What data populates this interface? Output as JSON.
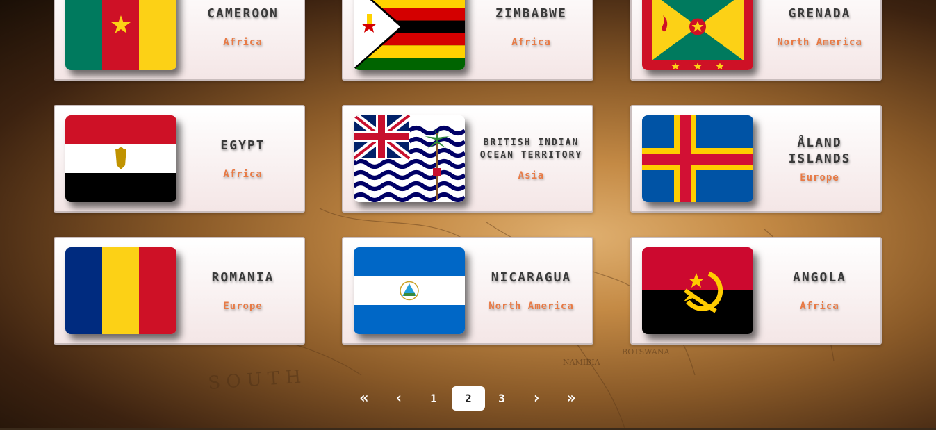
{
  "countries": [
    {
      "name": "CAMEROON",
      "region": "Africa"
    },
    {
      "name": "ZIMBABWE",
      "region": "Africa"
    },
    {
      "name": "GRENADA",
      "region": "North America"
    },
    {
      "name": "EGYPT",
      "region": "Africa"
    },
    {
      "name": "BRITISH INDIAN OCEAN TERRITORY",
      "region": "Asia"
    },
    {
      "name": "ÅLAND ISLANDS",
      "region": "Europe"
    },
    {
      "name": "ROMANIA",
      "region": "Europe"
    },
    {
      "name": "NICARAGUA",
      "region": "North America"
    },
    {
      "name": "ANGOLA",
      "region": "Africa"
    }
  ],
  "pagination": {
    "first": "«",
    "prev": "‹",
    "pages": [
      "1",
      "2",
      "3"
    ],
    "current": "2",
    "next": "›",
    "last": "»"
  }
}
